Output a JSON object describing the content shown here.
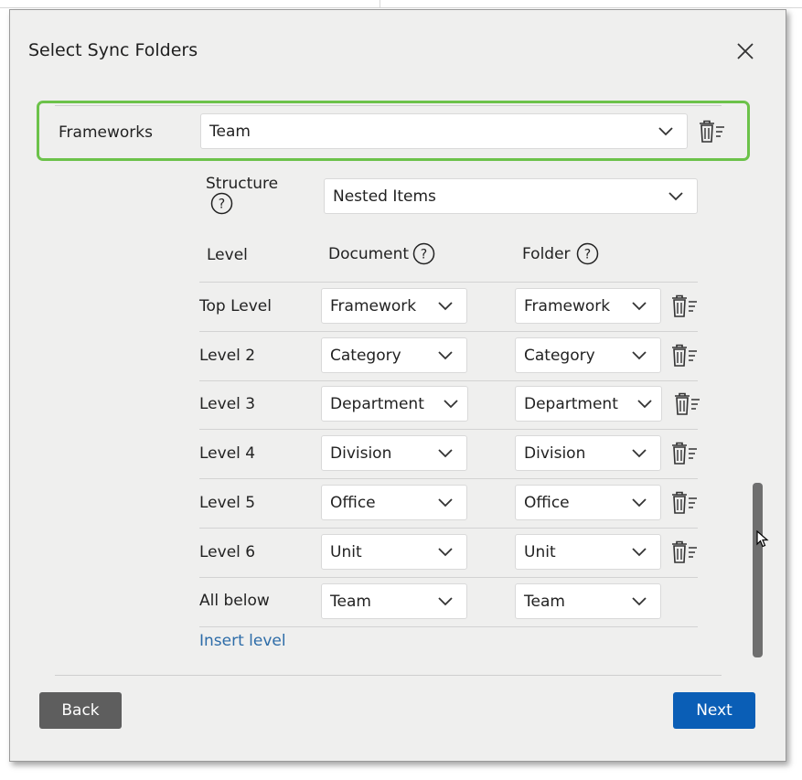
{
  "dialog": {
    "title": "Select Sync Folders"
  },
  "framework": {
    "label": "Frameworks",
    "value": "Team"
  },
  "structure": {
    "label": "Structure",
    "value": "Nested Items"
  },
  "columns": {
    "level": "Level",
    "document": "Document",
    "folder": "Folder"
  },
  "levels": [
    {
      "name": "Top Level",
      "document": "Framework",
      "folder": "Framework"
    },
    {
      "name": "Level 2",
      "document": "Category",
      "folder": "Category"
    },
    {
      "name": "Level 3",
      "document": "Department",
      "folder": "Department"
    },
    {
      "name": "Level 4",
      "document": "Division",
      "folder": "Division"
    },
    {
      "name": "Level 5",
      "document": "Office",
      "folder": "Office"
    },
    {
      "name": "Level 6",
      "document": "Unit",
      "folder": "Unit"
    },
    {
      "name": "All below",
      "document": "Team",
      "folder": "Team"
    }
  ],
  "actions": {
    "insert_level": "Insert level",
    "back": "Back",
    "next": "Next"
  },
  "colors": {
    "highlight_border": "#6cc24a",
    "primary_button": "#0a5eb6",
    "secondary_button": "#5e5e5e",
    "link": "#2d6ca8"
  }
}
